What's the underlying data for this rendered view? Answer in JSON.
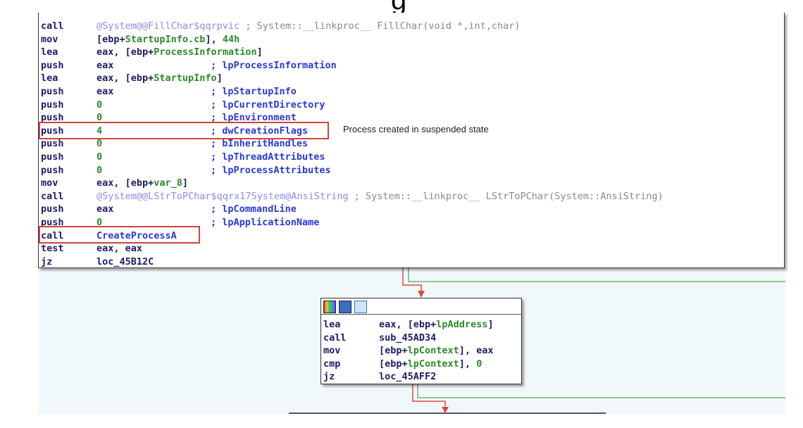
{
  "top_fragment": "g",
  "note": "Process created in suspended state",
  "colors": {
    "highlight": "#d2433a",
    "true_edge": "#e04a3a",
    "false_edge": "#6ab86a",
    "canvas": "#f1f8fc"
  },
  "node1": {
    "lines": [
      {
        "mn": "call",
        "op": [
          {
            "t": "@System@@FillChar$qqrpvic",
            "k": "lib"
          }
        ],
        "cm": [
          {
            "t": "; System::__linkproc__ FillChar(void *,int,char)",
            "k": "gray"
          }
        ],
        "inline": true
      },
      {
        "mn": "mov",
        "op": [
          {
            "t": "[ebp+",
            "k": "reg"
          },
          {
            "t": "StartupInfo.cb",
            "k": "name"
          },
          {
            "t": "], ",
            "k": "reg"
          },
          {
            "t": "44h",
            "k": "num"
          }
        ]
      },
      {
        "mn": "lea",
        "op": [
          {
            "t": "eax, [ebp+",
            "k": "reg"
          },
          {
            "t": "ProcessInformation",
            "k": "name"
          },
          {
            "t": "]",
            "k": "reg"
          }
        ]
      },
      {
        "mn": "push",
        "op": [
          {
            "t": "eax",
            "k": "reg"
          }
        ],
        "cm": [
          {
            "t": "; lpProcessInformation",
            "k": "cmt"
          }
        ]
      },
      {
        "mn": "lea",
        "op": [
          {
            "t": "eax, [ebp+",
            "k": "reg"
          },
          {
            "t": "StartupInfo",
            "k": "name"
          },
          {
            "t": "]",
            "k": "reg"
          }
        ]
      },
      {
        "mn": "push",
        "op": [
          {
            "t": "eax",
            "k": "reg"
          }
        ],
        "cm": [
          {
            "t": "; lpStartupInfo",
            "k": "cmt"
          }
        ]
      },
      {
        "mn": "push",
        "op": [
          {
            "t": "0",
            "k": "num"
          }
        ],
        "cm": [
          {
            "t": "; lpCurrentDirectory",
            "k": "cmt"
          }
        ]
      },
      {
        "mn": "push",
        "op": [
          {
            "t": "0",
            "k": "num"
          }
        ],
        "cm": [
          {
            "t": "; lpEnvironment",
            "k": "cmt"
          }
        ]
      },
      {
        "mn": "push",
        "op": [
          {
            "t": "4",
            "k": "num"
          }
        ],
        "cm": [
          {
            "t": "; dwCreationFlags",
            "k": "cmt"
          }
        ]
      },
      {
        "mn": "push",
        "op": [
          {
            "t": "0",
            "k": "num"
          }
        ],
        "cm": [
          {
            "t": "; bInheritHandles",
            "k": "cmt"
          }
        ]
      },
      {
        "mn": "push",
        "op": [
          {
            "t": "0",
            "k": "num"
          }
        ],
        "cm": [
          {
            "t": "; lpThreadAttributes",
            "k": "cmt"
          }
        ]
      },
      {
        "mn": "push",
        "op": [
          {
            "t": "0",
            "k": "num"
          }
        ],
        "cm": [
          {
            "t": "; lpProcessAttributes",
            "k": "cmt"
          }
        ]
      },
      {
        "mn": "mov",
        "op": [
          {
            "t": "eax, [ebp+",
            "k": "reg"
          },
          {
            "t": "var_8",
            "k": "name"
          },
          {
            "t": "]",
            "k": "reg"
          }
        ]
      },
      {
        "mn": "call",
        "op": [
          {
            "t": "@System@@LStrToPChar$qqrx17System@AnsiString",
            "k": "lib"
          },
          {
            "t": " ; System::__linkproc__ LStrToPChar(System::AnsiString)",
            "k": "gray"
          }
        ]
      },
      {
        "mn": "push",
        "op": [
          {
            "t": "eax",
            "k": "reg"
          }
        ],
        "cm": [
          {
            "t": "; lpCommandLine",
            "k": "cmt"
          }
        ]
      },
      {
        "mn": "push",
        "op": [
          {
            "t": "0",
            "k": "num"
          }
        ],
        "cm": [
          {
            "t": "; lpApplicationName",
            "k": "cmt"
          }
        ]
      },
      {
        "mn": "call",
        "op": [
          {
            "t": "CreateProcessA",
            "k": "code"
          }
        ]
      },
      {
        "mn": "test",
        "op": [
          {
            "t": "eax, eax",
            "k": "reg"
          }
        ]
      },
      {
        "mn": "jz",
        "op": [
          {
            "t": "loc_45B12C",
            "k": "reg"
          }
        ]
      }
    ]
  },
  "node2": {
    "header_icons": [
      "color-palette-icon",
      "edit-pencil-icon",
      "graph-view-icon"
    ],
    "lines": [
      {
        "mn": "lea",
        "op": [
          {
            "t": "eax, [ebp+",
            "k": "reg"
          },
          {
            "t": "lpAddress",
            "k": "name"
          },
          {
            "t": "]",
            "k": "reg"
          }
        ]
      },
      {
        "mn": "call",
        "op": [
          {
            "t": "sub_45AD34",
            "k": "reg"
          }
        ]
      },
      {
        "mn": "mov",
        "op": [
          {
            "t": "[ebp+",
            "k": "reg"
          },
          {
            "t": "lpContext",
            "k": "name"
          },
          {
            "t": "], eax",
            "k": "reg"
          }
        ]
      },
      {
        "mn": "cmp",
        "op": [
          {
            "t": "[ebp+",
            "k": "reg"
          },
          {
            "t": "lpContext",
            "k": "name"
          },
          {
            "t": "], ",
            "k": "reg"
          },
          {
            "t": "0",
            "k": "num"
          }
        ]
      },
      {
        "mn": "jz",
        "op": [
          {
            "t": "loc_45AFF2",
            "k": "reg"
          }
        ]
      }
    ]
  }
}
